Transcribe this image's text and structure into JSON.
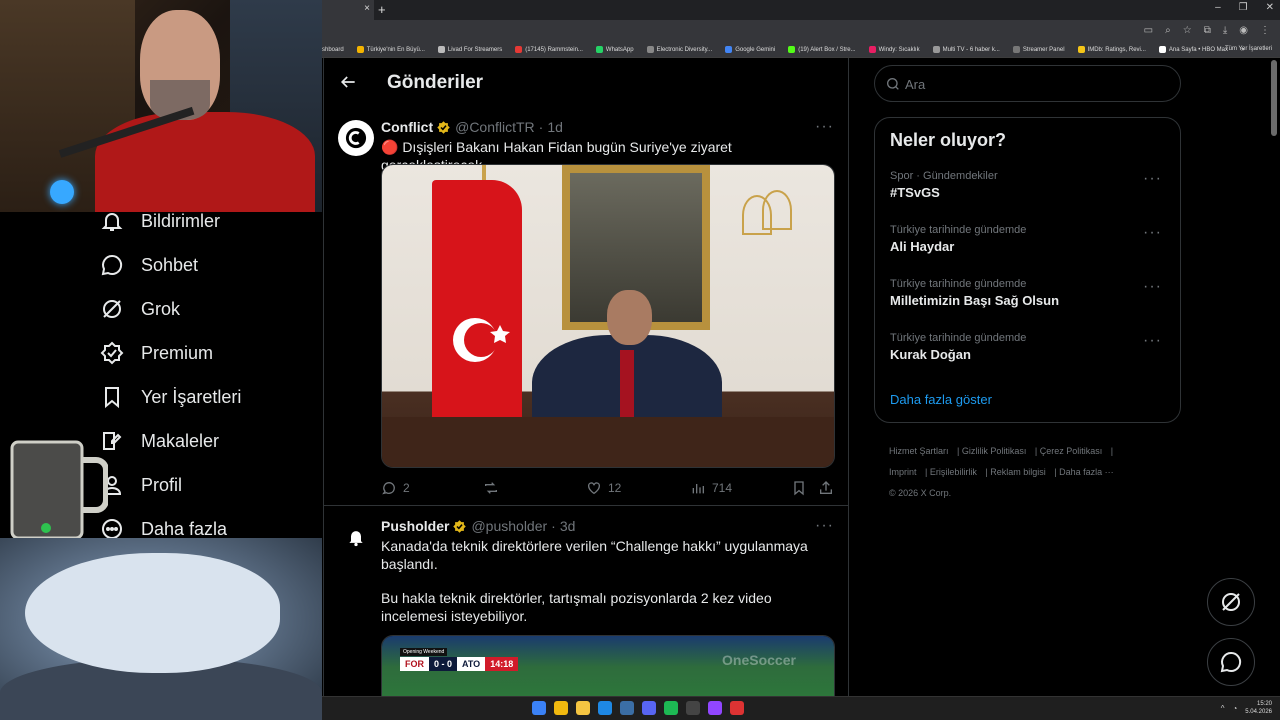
{
  "browser": {
    "new_tab": "+",
    "close_tab": "×",
    "bookmarks": [
      "shboard",
      "Türkiye'nin En Büyü...",
      "Livad For Streamers",
      "(17145) Rammstein...",
      "WhatsApp",
      "Electronic Diversity...",
      "Google Gemini",
      "(19) Alert Box / Stre...",
      "Windy: Sıcaklık",
      "Multi TV - 6 haber k...",
      "Streamer Panel",
      "IMDb: Ratings, Revi...",
      "Ana Sayfa • HBO Max"
    ],
    "bookmarks_more": "»",
    "all_bookmarks": "Tüm Yer İşaretleri"
  },
  "left_nav": [
    {
      "label": "Bildirimler",
      "icon": "bell-icon"
    },
    {
      "label": "Sohbet",
      "icon": "chat-icon"
    },
    {
      "label": "Grok",
      "icon": "grok-icon"
    },
    {
      "label": "Premium",
      "icon": "verified-icon"
    },
    {
      "label": "Yer İşaretleri",
      "icon": "bookmark-icon"
    },
    {
      "label": "Makaleler",
      "icon": "article-icon"
    },
    {
      "label": "Profil",
      "icon": "profile-icon"
    },
    {
      "label": "Daha fazla",
      "icon": "more-circle-icon"
    }
  ],
  "feed": {
    "title": "Gönderiler",
    "tweets": [
      {
        "name": "Conflict",
        "handle": "@ConflictTR",
        "time": "1d",
        "text": "🔴 Dışişleri Bakanı Hakan Fidan bugün Suriye'ye ziyaret gerçekleştirecek.",
        "replies": "2",
        "likes": "12",
        "views": "714"
      },
      {
        "name": "Pusholder",
        "handle": "@pusholder",
        "time": "3d",
        "text_1": "Kanada'da teknik direktörlere verilen “Challenge hakkı” uygulanmaya başlandı.",
        "text_2": "Bu hakla teknik direktörler, tartışmalı pozisyonlarda 2 kez video incelemesi isteyebiliyor.",
        "score": {
          "label": "Opening Weekend",
          "home": "FOR",
          "away": "ATO",
          "result": "0 - 0",
          "clock": "14:18",
          "watermark": "OneSoccer"
        }
      }
    ]
  },
  "search": {
    "placeholder": "Ara"
  },
  "trends": {
    "title": "Neler oluyor?",
    "items": [
      {
        "context": "Spor · Gündemdekiler",
        "topic": "#TSvGS"
      },
      {
        "context": "Türkiye tarihinde gündemde",
        "topic": "Ali Haydar"
      },
      {
        "context": "Türkiye tarihinde gündemde",
        "topic": "Milletimizin Başı Sağ Olsun"
      },
      {
        "context": "Türkiye tarihinde gündemde",
        "topic": "Kurak Doğan"
      }
    ],
    "show_more": "Daha fazla göster"
  },
  "footer": {
    "links": [
      "Hizmet Şartları",
      "Gizlilik Politikası",
      "Çerez Politikası",
      "Imprint",
      "Erişilebilirlik",
      "Reklam bilgisi",
      "Daha fazla ···"
    ],
    "copyright": "© 2026 X Corp."
  },
  "taskbar": {
    "time": "15:20",
    "date": "5.04.2026"
  },
  "colors": {
    "accent": "#1d9bf0",
    "verified_gold": "#e2b719",
    "background": "#000000",
    "border": "#2f3336",
    "muted": "#71767b"
  }
}
